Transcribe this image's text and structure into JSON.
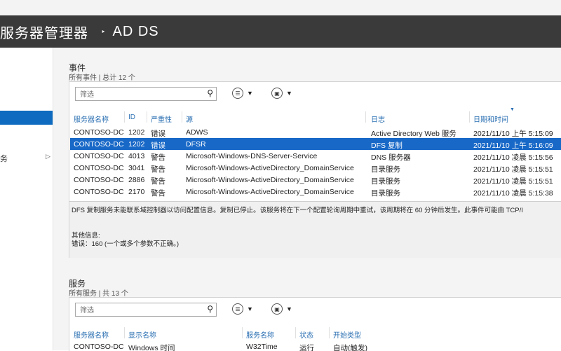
{
  "titlebar": {
    "app": "服务器管理器",
    "separator": "‣",
    "section": "AD DS"
  },
  "sidebar": {
    "items": [
      {
        "label": "务",
        "has_submenu": true
      }
    ]
  },
  "events": {
    "title": "事件",
    "subtitle": "所有事件 | 总计 12 个",
    "filter_placeholder": "筛选",
    "columns": [
      "服务器名称",
      "ID",
      "严重性",
      "源",
      "日志",
      "日期和时间"
    ],
    "rows": [
      {
        "server": "CONTOSO-DC",
        "id": "1202",
        "severity": "错误",
        "source": "ADWS",
        "log": "Active Directory Web 服务",
        "datetime": "2021/11/10 上午 5:15:09",
        "selected": false
      },
      {
        "server": "CONTOSO-DC",
        "id": "1202",
        "severity": "错误",
        "source": "DFSR",
        "log": "DFS 复制",
        "datetime": "2021/11/10 上午 5:16:09",
        "selected": true
      },
      {
        "server": "CONTOSO-DC",
        "id": "4013",
        "severity": "警告",
        "source": "Microsoft-Windows-DNS-Server-Service",
        "log": "DNS 服务器",
        "datetime": "2021/11/10 凌晨 5:15:56",
        "selected": false
      },
      {
        "server": "CONTOSO-DC",
        "id": "3041",
        "severity": "警告",
        "source": "Microsoft-Windows-ActiveDirectory_DomainService",
        "log": "目录服务",
        "datetime": "2021/11/10 凌晨 5:15:51",
        "selected": false
      },
      {
        "server": "CONTOSO-DC",
        "id": "2886",
        "severity": "警告",
        "source": "Microsoft-Windows-ActiveDirectory_DomainService",
        "log": "目录服务",
        "datetime": "2021/11/10 凌晨 5:15:51",
        "selected": false
      },
      {
        "server": "CONTOSO-DC",
        "id": "2170",
        "severity": "警告",
        "source": "Microsoft-Windows-ActiveDirectory_DomainService",
        "log": "目录服务",
        "datetime": "2021/11/10 凌晨 5:15:38",
        "selected": false
      }
    ],
    "detail": {
      "message": "DFS 复制服务未能联系域控制器以访问配置信息。复制已停止。该服务将在下一个配置轮询周期中重试，该周期将在 60 分钟后发生。此事件可能由 TCP/I",
      "extra_title": "其他信息:",
      "extra_line": "错误：160 (一个或多个参数不正确。)"
    }
  },
  "services": {
    "title": "服务",
    "subtitle": "所有服务 | 共 13 个",
    "filter_placeholder": "筛选",
    "columns": [
      "服务器名称",
      "显示名称",
      "服务名称",
      "状态",
      "开始类型"
    ],
    "rows": [
      {
        "server": "CONTOSO-DC",
        "display": "Windows 时间",
        "service": "W32Time",
        "status": "运行",
        "start": "自动(触发)"
      }
    ]
  },
  "icons": {
    "search": "magnifier-icon",
    "tasks": "list-icon",
    "save": "save-icon"
  }
}
